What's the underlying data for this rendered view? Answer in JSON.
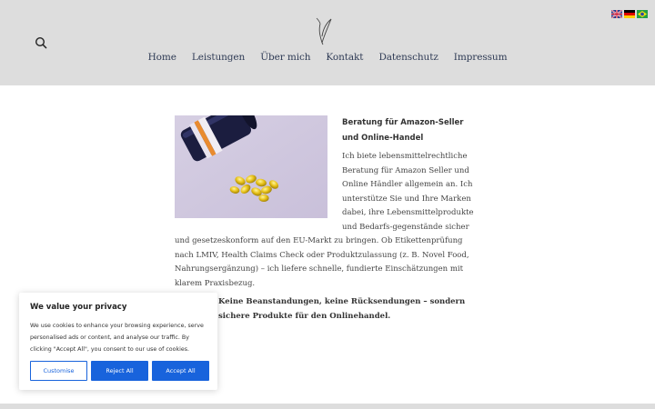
{
  "header": {
    "nav": [
      "Home",
      "Leistungen",
      "Über mich",
      "Kontakt",
      "Datenschutz",
      "Impressum"
    ],
    "languages": [
      "English",
      "Deutsch",
      "Português"
    ],
    "icons": {
      "search": "search-icon",
      "logo": "feather-logo"
    }
  },
  "article": {
    "heading": "Beratung für Amazon-Seller und Online-Handel",
    "body": "Ich biete lebensmittelrechtliche Beratung für Amazon Seller und Online Händler allgemein an. Ich unterstütze Sie und Ihre Marken dabei, ihre Lebensmittelprodukte und Bedarfs-gegenstände sicher und gesetzeskonform auf den EU-Markt zu bringen. Ob Etikettenprüfung nach LMIV, Health Claims Check oder Produktzulassung (z. B. Novel Food, Nahrungsergänzung) – ich liefere schnelle, fundierte Einschätzungen mit klarem Praxisbezug.",
    "claim": "Keine Beanstandungen, keine Rücksendungen – sondern sichere Produkte für den Onlinehandel."
  },
  "cookie": {
    "title": "We value your privacy",
    "text": "We use cookies to enhance your browsing experience, serve personalised ads or content, and analyse our traffic. By clicking \"Accept All\", you consent to our use of cookies.",
    "customise": "Customise",
    "reject": "Reject All",
    "accept": "Accept All"
  },
  "colors": {
    "header_bg": "#dddddd",
    "nav_text": "#2f3b55",
    "accent": "#1863dc"
  }
}
